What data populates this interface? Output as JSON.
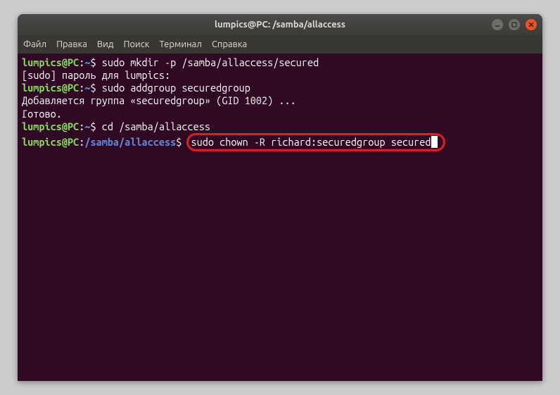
{
  "window": {
    "title": "lumpics@PC: /samba/allaccess"
  },
  "menubar": {
    "items": [
      "Файл",
      "Правка",
      "Вид",
      "Поиск",
      "Терминал",
      "Справка"
    ]
  },
  "terminal": {
    "line1": {
      "user": "lumpics@PC",
      "colon": ":",
      "path": "~",
      "dollar": "$ ",
      "cmd": "sudo mkdir -p /samba/allaccess/secured"
    },
    "line2": {
      "text": "[sudo] пароль для lumpics:"
    },
    "line3": {
      "user": "lumpics@PC",
      "colon": ":",
      "path": "~",
      "dollar": "$ ",
      "cmd": "sudo addgroup securedgroup"
    },
    "line4": {
      "text": "Добавляется группа «securedgroup» (GID 1002) ..."
    },
    "line5": {
      "text": "Готово."
    },
    "line6": {
      "user": "lumpics@PC",
      "colon": ":",
      "path": "~",
      "dollar": "$ ",
      "cmd": "cd /samba/allaccess"
    },
    "line7": {
      "user": "lumpics@PC",
      "colon": ":",
      "path": "/samba/allaccess",
      "dollar": "$ ",
      "cmd": "sudo chown -R richard:securedgroup secured"
    }
  }
}
